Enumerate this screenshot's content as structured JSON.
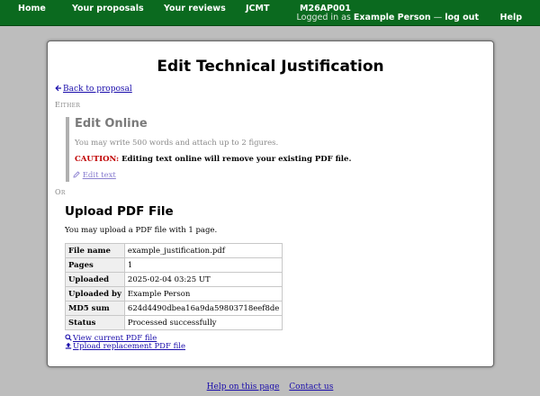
{
  "nav": {
    "home": "Home",
    "proposals": "Your proposals",
    "reviews": "Your reviews",
    "facility": "JCMT",
    "proposal_code": "M26AP001",
    "logged_in_prefix": "Logged in as",
    "user_name": "Example Person",
    "separator": "—",
    "logout": "log out",
    "help": "Help"
  },
  "page": {
    "title": "Edit Technical Justification",
    "back_link": "Back to proposal",
    "either": "Either",
    "or": "Or"
  },
  "edit_online": {
    "title": "Edit Online",
    "hint": "You may write 500 words and attach up to 2 figures.",
    "caution_label": "CAUTION:",
    "caution_text": "Editing text online will remove your existing PDF file.",
    "edit_link": "Edit text"
  },
  "upload": {
    "title": "Upload PDF File",
    "description": "You may upload a PDF file with 1 page.",
    "rows": [
      {
        "key": "File name",
        "value": "example_justification.pdf"
      },
      {
        "key": "Pages",
        "value": "1"
      },
      {
        "key": "Uploaded",
        "value": "2025-02-04 03:25 UT"
      },
      {
        "key": "Uploaded by",
        "value": "Example Person"
      },
      {
        "key": "MD5 sum",
        "value": "624d4490dbea16a9da59803718eef8de"
      },
      {
        "key": "Status",
        "value": "Processed successfully"
      }
    ],
    "view_link": "View current PDF file",
    "replace_link": "Upload replacement PDF file"
  },
  "footer": {
    "help": "Help on this page",
    "contact": "Contact us"
  },
  "icons": {
    "back": "arrow-left-icon",
    "edit": "pencil-icon",
    "view": "magnifier-icon",
    "upload": "upload-icon"
  },
  "colors": {
    "nav_bg": "#0b6a1f",
    "page_bg": "#bdbdbd",
    "caution": "#c00000",
    "link": "#1a0dab"
  }
}
